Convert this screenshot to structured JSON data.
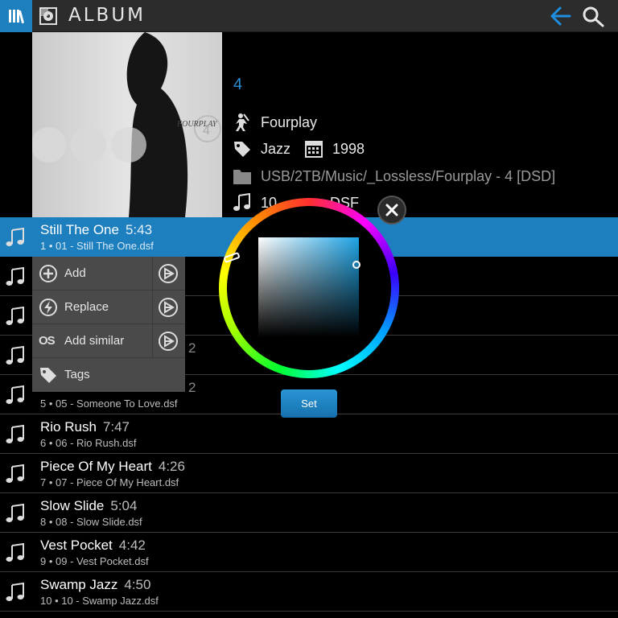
{
  "topbar": {
    "title": "ALBUM",
    "icons": {
      "library": "library-icon",
      "album": "album-icon",
      "back": "back-arrow-icon",
      "search": "search-icon"
    },
    "accent": "#1e7fbf"
  },
  "header": {
    "album_name": "4",
    "artist": "Fourplay",
    "genre": "Jazz",
    "year": "1998",
    "path": "USB/2TB/Music/_Lossless/Fourplay - 4 [DSD]",
    "format_partial_count": "10",
    "format_partial_type": "DSF",
    "cover_text": "FOURPLAY",
    "cover_number": "4"
  },
  "tracks": [
    {
      "title": "Still The One",
      "duration": "5:43",
      "sub": "1 • 01 - Still The One.dsf",
      "selected": true
    },
    {
      "title": "",
      "duration": "",
      "sub": ""
    },
    {
      "title": "",
      "duration": "",
      "sub": ""
    },
    {
      "title": "",
      "duration": "2",
      "sub": ""
    },
    {
      "title": "",
      "duration": "2",
      "sub": "5 • 05 - Someone To Love.dsf"
    },
    {
      "title": "Rio Rush",
      "duration": "7:47",
      "sub": "6 • 06 - Rio Rush.dsf"
    },
    {
      "title": "Piece Of My Heart",
      "duration": "4:26",
      "sub": "7 • 07 - Piece Of My Heart.dsf"
    },
    {
      "title": "Slow Slide",
      "duration": "5:04",
      "sub": "8 • 08 - Slow Slide.dsf"
    },
    {
      "title": "Vest Pocket",
      "duration": "4:42",
      "sub": "9 • 09 - Vest Pocket.dsf"
    },
    {
      "title": "Swamp Jazz",
      "duration": "4:50",
      "sub": "10 • 10 - Swamp Jazz.dsf"
    }
  ],
  "menu": {
    "items": [
      {
        "label": "Add",
        "icon": "add-circle-icon",
        "has_play": true
      },
      {
        "label": "Replace",
        "icon": "lightning-icon",
        "has_play": true
      },
      {
        "label": "Add similar",
        "icon": "lastfm-icon",
        "has_play": true
      },
      {
        "label": "Tags",
        "icon": "tag-icon",
        "has_play": false
      }
    ],
    "lastfm_text": "OS"
  },
  "picker": {
    "set_label": "Set",
    "close_icon": "close-icon",
    "selected_color": "#1ea4e6"
  }
}
